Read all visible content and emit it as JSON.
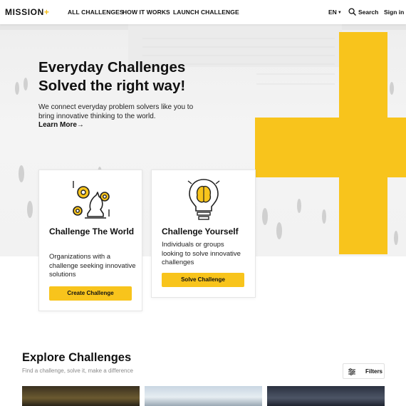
{
  "nav": {
    "logo_text": "MISSION",
    "logo_mark": "+",
    "links": [
      "ALL CHALLENGES",
      "HOW IT WORKS",
      "LAUNCH CHALLENGE"
    ],
    "language": "EN",
    "search_label": "Search",
    "signin_label": "Sign in"
  },
  "hero": {
    "title_line1": "Everyday Challenges",
    "title_line2": "Solved the right way!",
    "subtitle_line1": "We connect everyday problem solvers like you to",
    "subtitle_line2": "bring innovative thinking to the world.",
    "learn_more": "Learn More→",
    "accent_color": "#f8c41c"
  },
  "cards": [
    {
      "icon": "gears-chess-knight-icon",
      "title": "Challenge The World",
      "text": "Organizations with a challenge seeking innovative solutions",
      "button": "Create Challenge"
    },
    {
      "icon": "brain-lightbulb-icon",
      "title": "Challenge Yourself",
      "text": "Individuals or groups looking to solve innovative challenges",
      "button": "Solve Challenge"
    }
  ],
  "explore": {
    "title": "Explore Challenges",
    "subtitle": "Find a challenge, solve it, make a difference",
    "filters_label": "Filters"
  }
}
